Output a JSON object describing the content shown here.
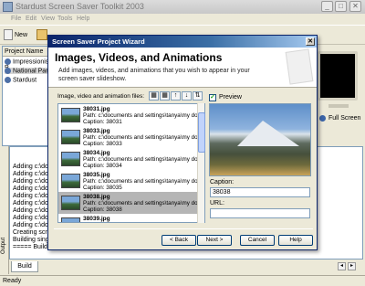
{
  "main": {
    "title": "Stardust Screen Saver Toolkit 2003",
    "menu": [
      "File",
      "Edit",
      "View",
      "Tools",
      "Help"
    ],
    "toolbar_new": "New",
    "tree_header": "Project Name",
    "tree_items": [
      "Impressionist P",
      "National Parks",
      "Stardust"
    ],
    "full_screen": "Full Screen",
    "output_lines": [
      "Adding c:\\docu",
      "Adding c:\\docu",
      "Adding c:\\docu",
      "Adding c:\\docu",
      "Adding c:\\docu",
      "Adding c:\\docu",
      "Adding c:\\docu",
      "Adding c:\\docu",
      "Adding c:\\docu",
      "Creating scree",
      "Building single",
      "===== Build complete ====="
    ],
    "output_tab": "Output",
    "build_tab": "Build",
    "status": "Ready"
  },
  "dialog": {
    "title": "Screen Saver Project Wizard",
    "close": "✕",
    "heading": "Images, Videos, and Animations",
    "subheading": "Add images, videos, and animations that you wish to appear in your screen saver slideshow.",
    "list_label": "Image, video and animation files:",
    "list_buttons": [
      "▦",
      "▦",
      "↑",
      "↓",
      "⇅"
    ],
    "files": [
      {
        "name": "38031.jpg",
        "path": "Path: c:\\documents and settings\\tanya\\my docu",
        "caption": "Caption: 38031",
        "selected": false
      },
      {
        "name": "38033.jpg",
        "path": "Path: c:\\documents and settings\\tanya\\my docu",
        "caption": "Caption: 38033",
        "selected": false
      },
      {
        "name": "38034.jpg",
        "path": "Path: c:\\documents and settings\\tanya\\my docu",
        "caption": "Caption: 38034",
        "selected": false
      },
      {
        "name": "38035.jpg",
        "path": "Path: c:\\documents and settings\\tanya\\my docu",
        "caption": "Caption: 38035",
        "selected": false
      },
      {
        "name": "38038.jpg",
        "path": "Path: c:\\documents and settings\\tanya\\my docu",
        "caption": "Caption: 38038",
        "selected": true
      },
      {
        "name": "38039.jpg",
        "path": "",
        "caption": "",
        "selected": false
      }
    ],
    "preview_label": "Preview",
    "preview_checked": true,
    "caption_label": "Caption:",
    "caption_value": "38038",
    "url_label": "URL:",
    "url_value": "",
    "back": "< Back",
    "next": "Next >",
    "cancel": "Cancel",
    "help": "Help"
  }
}
